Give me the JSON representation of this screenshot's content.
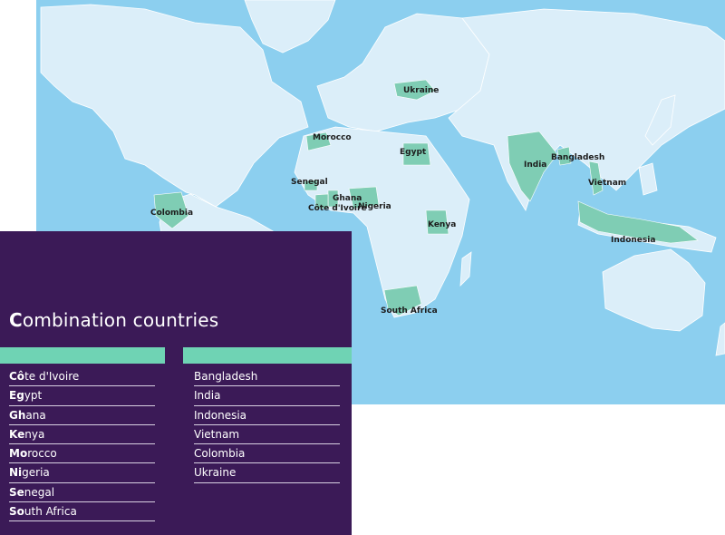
{
  "map": {
    "colors": {
      "ocean": "#8ccfef",
      "land": "#dbeef9",
      "highlight": "#7fcdb4",
      "border": "#ffffff"
    },
    "labels": {
      "ukraine": "Ukraine",
      "morocco": "Morocco",
      "egypt": "Egypt",
      "india": "India",
      "bangladesh": "Bangladesh",
      "senegal": "Senegal",
      "ghana": "Ghana",
      "cote_divoire": "Côte d'Ivoire",
      "nigeria": "Nigeria",
      "vietnam": "Vietnam",
      "colombia": "Colombia",
      "kenya": "Kenya",
      "indonesia": "Indonesia",
      "south_africa": "South Africa"
    }
  },
  "panel": {
    "title_first": "C",
    "title_rest": "ombination countries",
    "colors": {
      "background": "#3b1a57",
      "accent_bar": "#6fd3b4"
    },
    "left_list": [
      {
        "bold": "Cô",
        "rest": "te d'Ivoire"
      },
      {
        "bold": "Eg",
        "rest": "ypt"
      },
      {
        "bold": "Gh",
        "rest": "ana"
      },
      {
        "bold": "Ke",
        "rest": "nya"
      },
      {
        "bold": "Mo",
        "rest": "rocco"
      },
      {
        "bold": "Ni",
        "rest": "geria"
      },
      {
        "bold": "Se",
        "rest": "negal"
      },
      {
        "bold": "So",
        "rest": "uth Africa"
      }
    ],
    "right_list": [
      "Bangladesh",
      "India",
      "Indonesia",
      "Vietnam",
      "Colombia",
      "Ukraine"
    ]
  }
}
